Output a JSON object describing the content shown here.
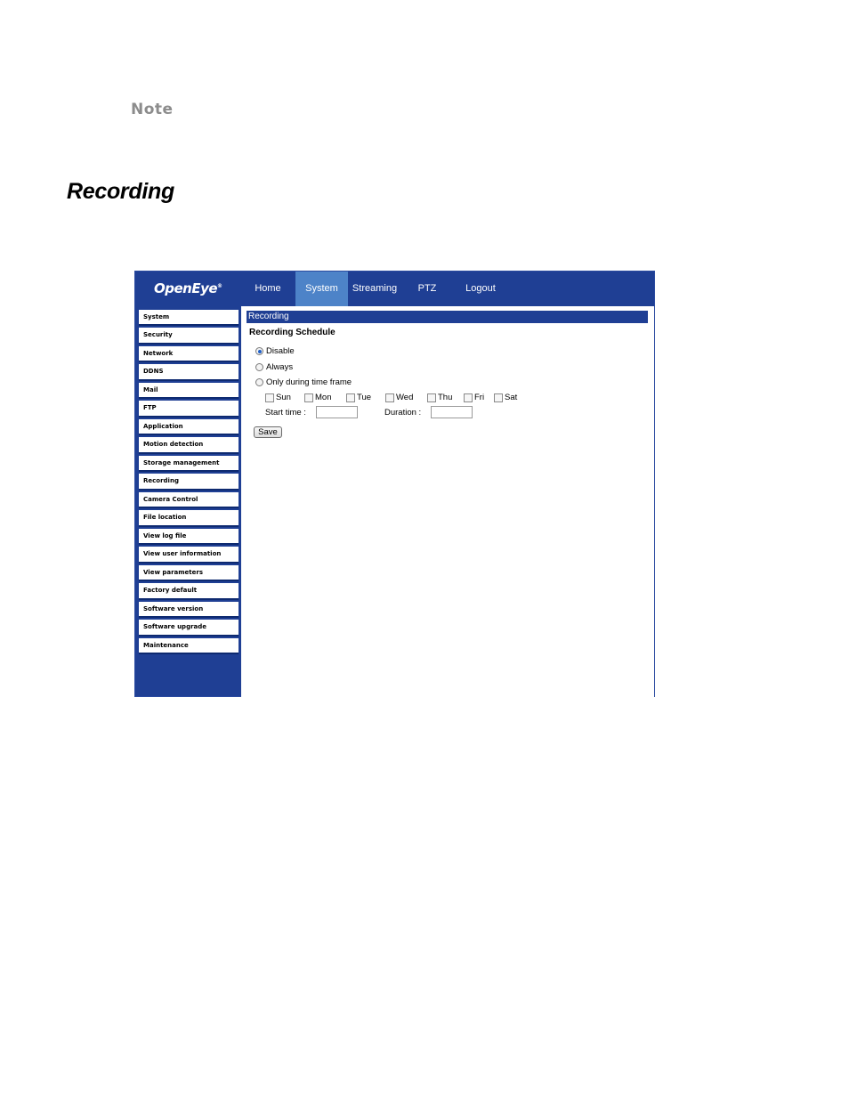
{
  "doc": {
    "note_label": "Note",
    "section_heading": "Recording"
  },
  "app": {
    "logo": "OpenEye",
    "logo_mark": "®",
    "nav": [
      {
        "label": "Home"
      },
      {
        "label": "System"
      },
      {
        "label": "Streaming"
      },
      {
        "label": "PTZ"
      },
      {
        "label": "Logout"
      }
    ],
    "active_nav": "System",
    "sidebar": [
      {
        "label": "System"
      },
      {
        "label": "Security"
      },
      {
        "label": "Network"
      },
      {
        "label": "DDNS"
      },
      {
        "label": "Mail"
      },
      {
        "label": "FTP"
      },
      {
        "label": "Application"
      },
      {
        "label": "Motion detection"
      },
      {
        "label": "Storage management"
      },
      {
        "label": "Recording"
      },
      {
        "label": "Camera Control"
      },
      {
        "label": "File location"
      },
      {
        "label": "View log file"
      },
      {
        "label": "View user information"
      },
      {
        "label": "View parameters"
      },
      {
        "label": "Factory default"
      },
      {
        "label": "Software version"
      },
      {
        "label": "Software upgrade"
      },
      {
        "label": "Maintenance"
      }
    ],
    "content": {
      "section_title": "Recording",
      "schedule_title": "Recording Schedule",
      "options": [
        {
          "label": "Disable",
          "selected": true
        },
        {
          "label": "Always",
          "selected": false
        },
        {
          "label": "Only during time frame",
          "selected": false
        }
      ],
      "days": [
        {
          "label": "Sun",
          "checked": false
        },
        {
          "label": "Mon",
          "checked": false
        },
        {
          "label": "Tue",
          "checked": false
        },
        {
          "label": "Wed",
          "checked": false
        },
        {
          "label": "Thu",
          "checked": false
        },
        {
          "label": "Fri",
          "checked": false
        },
        {
          "label": "Sat",
          "checked": false
        }
      ],
      "start_time_label": "Start time :",
      "start_time_value": "",
      "duration_label": "Duration :",
      "duration_value": "",
      "save_label": "Save"
    },
    "colors": {
      "brand": "#1f3f94",
      "active_tab": "#4d83c8"
    }
  }
}
